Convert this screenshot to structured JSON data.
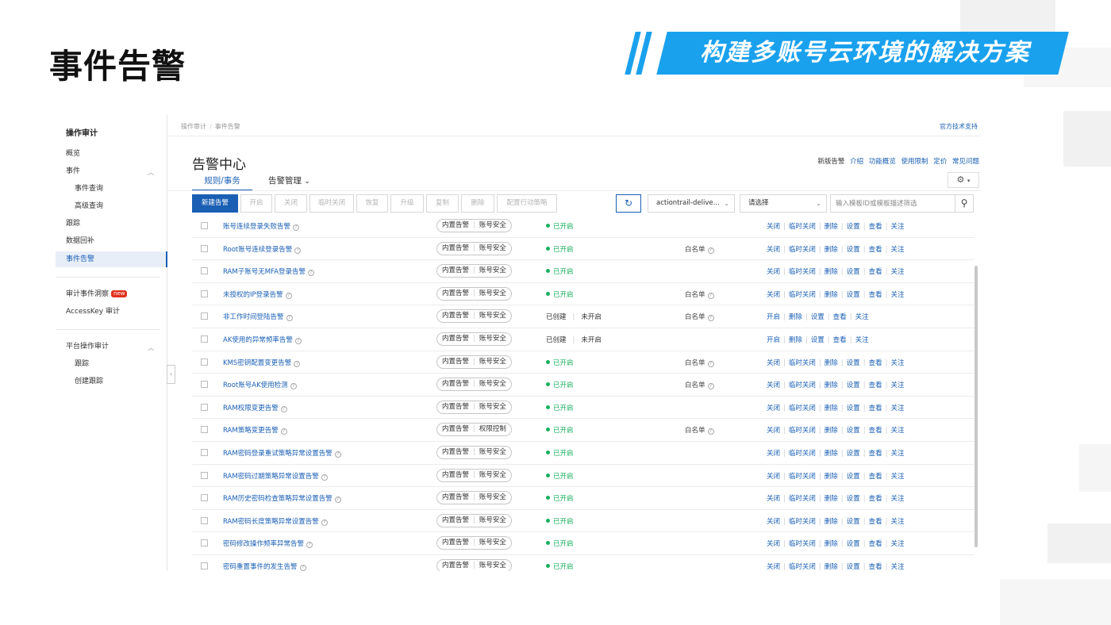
{
  "slide": {
    "title": "事件告警",
    "banner": "构建多账号云环境的解决方案"
  },
  "sidebar": {
    "title": "操作审计",
    "items": [
      {
        "label": "概览"
      },
      {
        "label": "事件"
      },
      {
        "label": "事件查询"
      },
      {
        "label": "高级查询"
      },
      {
        "label": "跟踪"
      },
      {
        "label": "数据回补"
      },
      {
        "label": "事件告警"
      },
      {
        "label": "审计事件洞察"
      },
      {
        "label": "AccessKey 审计"
      },
      {
        "label": "平台操作审计"
      },
      {
        "label": "跟踪"
      },
      {
        "label": "创建跟踪"
      }
    ],
    "new_badge": "new",
    "caret_up": "︿"
  },
  "breadcrumb": {
    "items": [
      "操作审计",
      "事件告警"
    ]
  },
  "top_link": "官方技术支持",
  "page": {
    "title": "告警中心",
    "header_links": [
      "新版告警",
      "介绍",
      "功能概览",
      "使用限制",
      "定价",
      "常见问题"
    ],
    "tabs": [
      {
        "label": "规则/事务"
      },
      {
        "label": "告警管理"
      }
    ],
    "tab_dropdown_icon": "chevron-down-icon"
  },
  "toolbar": {
    "buttons": [
      "新建告警",
      "开启",
      "关闭",
      "临时关闭",
      "恢复",
      "升级",
      "复制",
      "删除",
      "配置行动策略"
    ],
    "refresh_icon": "refresh-icon",
    "select1": "actiontrail-delive...",
    "select2": "请选择",
    "search_placeholder": "输入模板ID或模板描述筛选",
    "search_icon": "search-icon"
  },
  "rows": [
    {
      "name": "账号连续登录失败告警",
      "tag1": "内置告警",
      "tag2": "账号安全",
      "status": "已开启",
      "created": false,
      "whitelist": "",
      "actions": [
        "关闭",
        "临时关闭",
        "删除",
        "设置",
        "查看",
        "关注"
      ]
    },
    {
      "name": "Root账号连续登录告警",
      "tag1": "内置告警",
      "tag2": "账号安全",
      "status": "已开启",
      "created": false,
      "whitelist": "白名单",
      "actions": [
        "关闭",
        "临时关闭",
        "删除",
        "设置",
        "查看",
        "关注"
      ]
    },
    {
      "name": "RAM子账号无MFA登录告警",
      "tag1": "内置告警",
      "tag2": "账号安全",
      "status": "已开启",
      "created": false,
      "whitelist": "",
      "actions": [
        "关闭",
        "临时关闭",
        "删除",
        "设置",
        "查看",
        "关注"
      ]
    },
    {
      "name": "未授权的IP登录告警",
      "tag1": "内置告警",
      "tag2": "账号安全",
      "status": "已开启",
      "created": false,
      "whitelist": "白名单",
      "actions": [
        "关闭",
        "临时关闭",
        "删除",
        "设置",
        "查看",
        "关注"
      ]
    },
    {
      "name": "非工作时间登陆告警",
      "tag1": "内置告警",
      "tag2": "账号安全",
      "status": "已创建",
      "status2": "未开启",
      "created": true,
      "whitelist": "白名单",
      "actions": [
        "开启",
        "删除",
        "设置",
        "查看",
        "关注"
      ]
    },
    {
      "name": "AK使用的异常频率告警",
      "tag1": "内置告警",
      "tag2": "账号安全",
      "status": "已创建",
      "status2": "未开启",
      "created": true,
      "whitelist": "",
      "actions": [
        "开启",
        "删除",
        "设置",
        "查看",
        "关注"
      ]
    },
    {
      "name": "KMS密钥配置变更告警",
      "tag1": "内置告警",
      "tag2": "账号安全",
      "status": "已开启",
      "created": false,
      "whitelist": "白名单",
      "actions": [
        "关闭",
        "临时关闭",
        "删除",
        "设置",
        "查看",
        "关注"
      ]
    },
    {
      "name": "Root账号AK使用检测",
      "tag1": "内置告警",
      "tag2": "账号安全",
      "status": "已开启",
      "created": false,
      "whitelist": "白名单",
      "actions": [
        "关闭",
        "临时关闭",
        "删除",
        "设置",
        "查看",
        "关注"
      ]
    },
    {
      "name": "RAM权限变更告警",
      "tag1": "内置告警",
      "tag2": "账号安全",
      "status": "已开启",
      "created": false,
      "whitelist": "",
      "actions": [
        "关闭",
        "临时关闭",
        "删除",
        "设置",
        "查看",
        "关注"
      ]
    },
    {
      "name": "RAM策略变更告警",
      "tag1": "内置告警",
      "tag2": "权限控制",
      "status": "已开启",
      "created": false,
      "whitelist": "白名单",
      "actions": [
        "关闭",
        "临时关闭",
        "删除",
        "设置",
        "查看",
        "关注"
      ]
    },
    {
      "name": "RAM密码登录重试策略异常设置告警",
      "tag1": "内置告警",
      "tag2": "账号安全",
      "status": "已开启",
      "created": false,
      "whitelist": "",
      "actions": [
        "关闭",
        "临时关闭",
        "删除",
        "设置",
        "查看",
        "关注"
      ]
    },
    {
      "name": "RAM密码过期策略异常设置告警",
      "tag1": "内置告警",
      "tag2": "账号安全",
      "status": "已开启",
      "created": false,
      "whitelist": "",
      "actions": [
        "关闭",
        "临时关闭",
        "删除",
        "设置",
        "查看",
        "关注"
      ]
    },
    {
      "name": "RAM历史密码检查策略异常设置告警",
      "tag1": "内置告警",
      "tag2": "账号安全",
      "status": "已开启",
      "created": false,
      "whitelist": "",
      "actions": [
        "关闭",
        "临时关闭",
        "删除",
        "设置",
        "查看",
        "关注"
      ]
    },
    {
      "name": "RAM密码长度策略异常设置告警",
      "tag1": "内置告警",
      "tag2": "账号安全",
      "status": "已开启",
      "created": false,
      "whitelist": "",
      "actions": [
        "关闭",
        "临时关闭",
        "删除",
        "设置",
        "查看",
        "关注"
      ]
    },
    {
      "name": "密码修改操作频率异常告警",
      "tag1": "内置告警",
      "tag2": "账号安全",
      "status": "已开启",
      "created": false,
      "whitelist": "",
      "actions": [
        "关闭",
        "临时关闭",
        "删除",
        "设置",
        "查看",
        "关注"
      ]
    },
    {
      "name": "密码重置事件的发生告警",
      "tag1": "内置告警",
      "tag2": "账号安全",
      "status": "已开启",
      "created": false,
      "whitelist": "",
      "actions": [
        "关闭",
        "临时关闭",
        "删除",
        "设置",
        "查看",
        "关注"
      ]
    }
  ],
  "colors": {
    "primary": "#1a5fb4",
    "banner": "#1aa1ee",
    "status_on": "#19b05e",
    "new_badge": "#e0311e"
  }
}
